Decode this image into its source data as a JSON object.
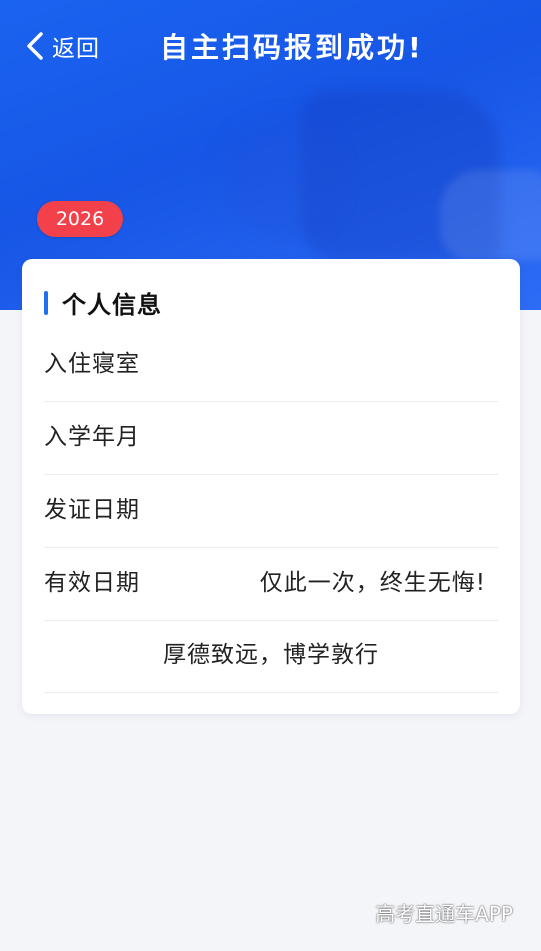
{
  "header": {
    "back_label": "返回",
    "title": "自主扫码报到成功!"
  },
  "badge": {
    "year": "2026"
  },
  "card": {
    "section_title": "个人信息",
    "rows": [
      {
        "label": "入住寝室",
        "value": ""
      },
      {
        "label": "入学年月",
        "value": ""
      },
      {
        "label": "发证日期",
        "value": ""
      },
      {
        "label": "有效日期",
        "value": "仅此一次，终生无悔!"
      }
    ],
    "motto": "厚德致远，博学敦行"
  },
  "watermark": "高考直通车APP",
  "colors": {
    "header_blue": "#1a63f0",
    "badge_red": "#f2414a",
    "accent_bar": "#1f6ff0",
    "page_bg": "#f4f5f9"
  },
  "icons": {
    "back": "chevron-left-icon"
  }
}
